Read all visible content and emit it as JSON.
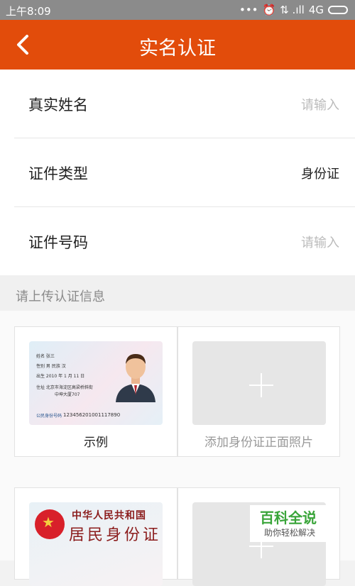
{
  "status_bar": {
    "time": "上午8:09",
    "dots": "•••",
    "alarm_icon": "alarm-clock-icon",
    "signal_icons": "⇅ .ıll",
    "network": "4G"
  },
  "header": {
    "back_icon": "chevron-left-icon",
    "title": "实名认证",
    "color": "#e24c0b"
  },
  "form": {
    "rows": [
      {
        "label": "真实姓名",
        "value": "请输入"
      },
      {
        "label": "证件类型",
        "value": "身份证"
      },
      {
        "label": "证件号码",
        "value": "请输入"
      }
    ]
  },
  "upload": {
    "section_title": "请上传认证信息",
    "sample": {
      "caption": "示例",
      "card_lines": [
        "姓名 张三",
        "性别 男    民族 汉",
        "出生 2010 年 1 月 11 日",
        "住址 北京市海淀区高梁桥斜街",
        "中坤大厦707"
      ],
      "card_number_label": "公民身份号码",
      "card_number": "123456201001117890"
    },
    "front": {
      "caption": "添加身份证正面照片"
    },
    "back_sample": {
      "title": "中华人民共和国",
      "subtitle": "居民身份证"
    }
  },
  "watermark": {
    "title": "百科全说",
    "subtitle": "助你轻松解决"
  }
}
